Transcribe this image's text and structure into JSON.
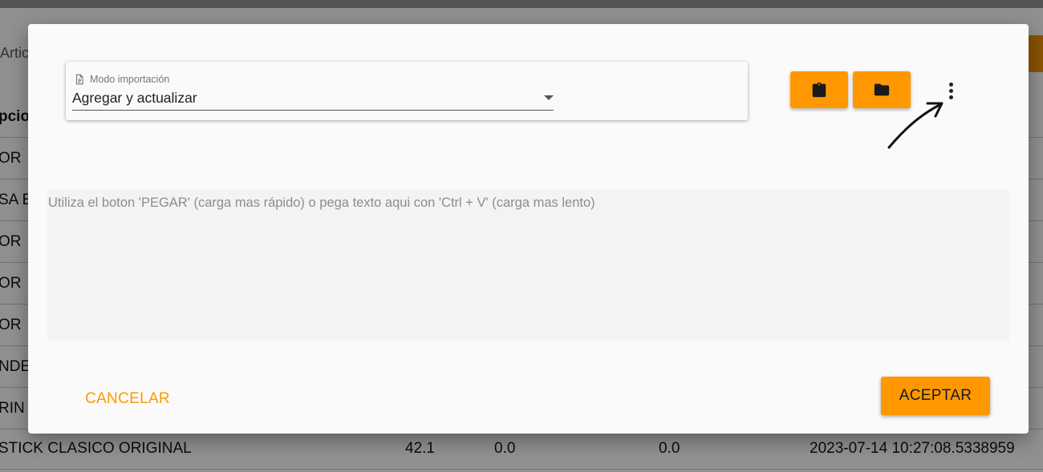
{
  "background": {
    "search_placeholder": "Articu",
    "header_col0": "pcio",
    "rows": [
      {
        "col0": "OR"
      },
      {
        "col0": "SA E"
      },
      {
        "col0": "OR"
      },
      {
        "col0": "OR"
      },
      {
        "col0": "OR"
      },
      {
        "col0": "NDE"
      },
      {
        "col0": "RIN"
      }
    ],
    "last_row": {
      "name": "STICK CLASICO ORIGINAL",
      "v1": "42.1",
      "v2": "0.0",
      "v3": "0.0",
      "date": "2023-07-14 10:27:08.5338959"
    }
  },
  "dialog": {
    "import_mode": {
      "label": "Modo importación",
      "label_icon": "document-icon",
      "value": "Agregar y actualizar"
    },
    "toolbar": {
      "paste_icon": "clipboard-icon",
      "open_icon": "folder-icon",
      "more_icon": "more-vertical-icon"
    },
    "textarea": {
      "placeholder": "Utiliza el boton 'PEGAR' (carga mas rápido) o pega texto aqui con 'Ctrl + V' (carga mas lento)",
      "value": ""
    },
    "cancel_label": "CANCELAR",
    "accept_label": "ACEPTAR"
  },
  "colors": {
    "accent": "#ff9800",
    "dialog_bg": "#fafafa",
    "textarea_bg": "#f3f3f3"
  }
}
